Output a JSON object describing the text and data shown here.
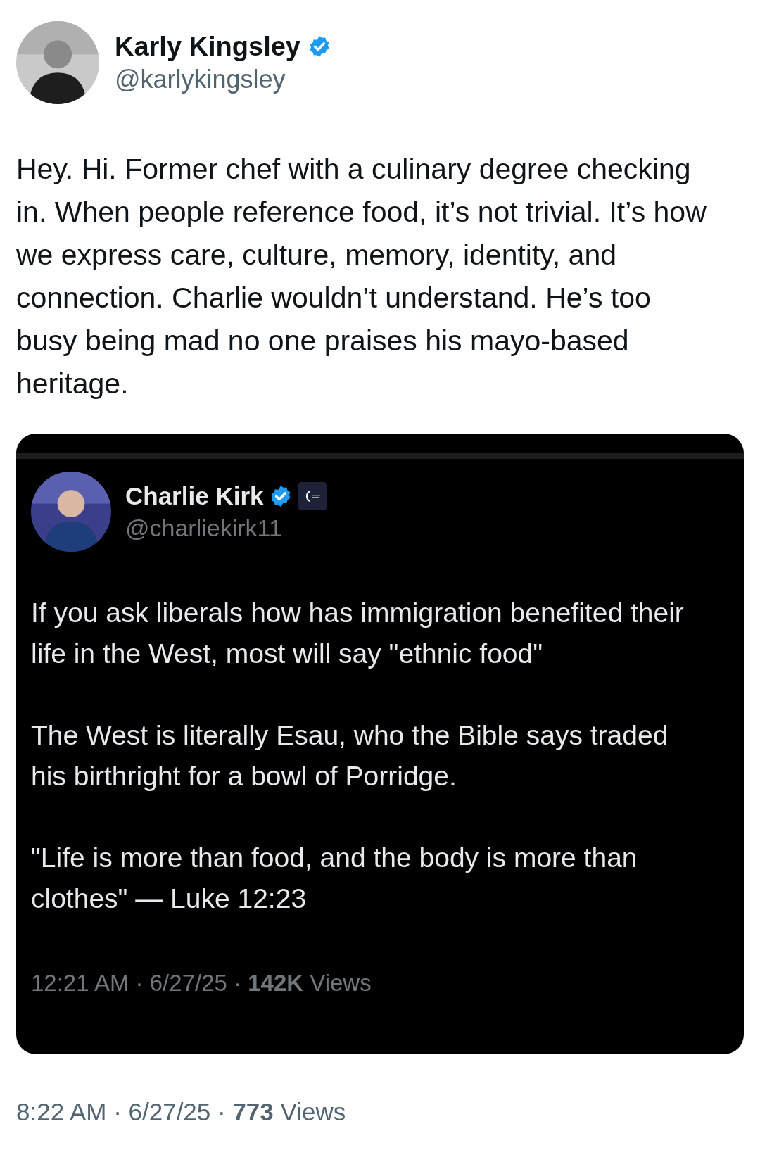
{
  "author": {
    "name": "Karly Kingsley",
    "verified": true,
    "handle": "@karlykingsley"
  },
  "text": "Hey. Hi. Former chef with a culinary degree checking in. When people reference food, it’s not trivial. It’s how we express care, culture, memory, identity, and connection. Charlie wouldn’t understand. He’s too busy being mad no one praises his mayo-based heritage.",
  "quoted_post": {
    "author": {
      "name": "Charlie Kirk",
      "verified": true,
      "affiliate_badge": true,
      "handle": "@charliekirk11"
    },
    "paragraphs": [
      "If you ask liberals how has immigration benefited their life in the West, most will say \"ethnic food\"",
      "The West is literally Esau, who the Bible says traded his birthright for a bowl of Porridge.",
      "\"Life is more than food, and the body is more than clothes\" — Luke 12:23"
    ],
    "meta": "12:21 AM · 6/27/25 · **142K** Views"
  },
  "meta": "8:22 AM · 6/27/25 · **773** Views"
}
